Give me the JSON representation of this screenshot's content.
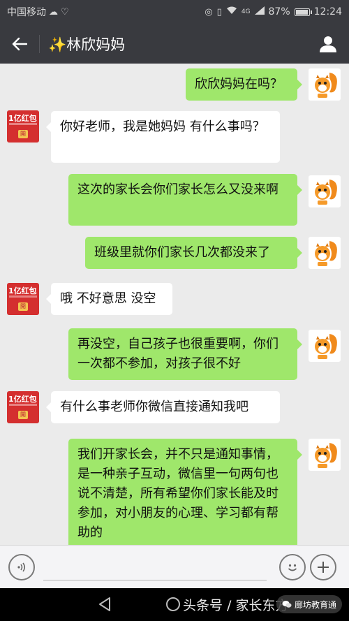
{
  "status": {
    "carrier": "中国移动",
    "network": "4G",
    "battery": "87%",
    "time": "12:24"
  },
  "header": {
    "title": "✨林欣妈妈"
  },
  "messages": [
    {
      "side": "right",
      "text": "欣欣妈妈在吗？"
    },
    {
      "side": "left",
      "text": "你好老师，我是她妈妈 有什么事吗？"
    },
    {
      "side": "right",
      "text": "这次的家长会你们家长怎么又没来啊"
    },
    {
      "side": "right",
      "text": "班级里就你们家长几次都没来了"
    },
    {
      "side": "left",
      "text": "哦 不好意思 没空"
    },
    {
      "side": "right",
      "text": "再没空，自己孩子也很重要啊，你们一次都不参加，对孩子很不好"
    },
    {
      "side": "left",
      "text": "有什么事老师你微信直接通知我吧"
    },
    {
      "side": "right",
      "text": "我们开家长会，并不只是通知事情，是一种亲子互动，微信里一句两句也说不清楚，所有希望你们家长能及时参加，对小朋友的心理、学习都有帮助的"
    }
  ],
  "avatars": {
    "contact_label": "1亿红包",
    "self_icon": "squirrel-avatar"
  },
  "watermark": {
    "text": "头条号 / 家长东方",
    "badge": "廊坊教育通"
  },
  "colors": {
    "header_bg": "#393a3f",
    "chat_bg": "#ebebeb",
    "bubble_self": "#9fe76b",
    "bubble_other": "#ffffff"
  }
}
